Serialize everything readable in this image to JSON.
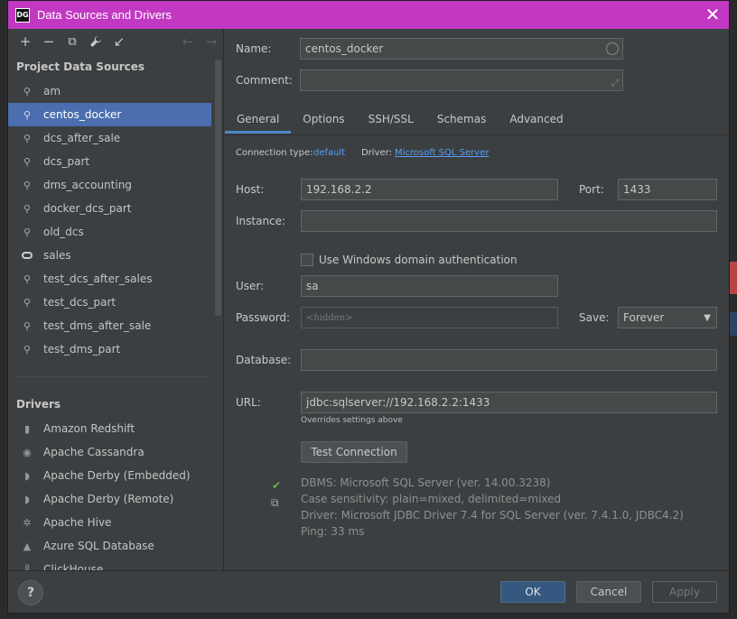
{
  "window": {
    "app_logo": "DG",
    "title": "Data Sources and Drivers",
    "close": "✕"
  },
  "toolbar": {
    "add": "+",
    "remove": "−",
    "duplicate": "⧉",
    "settings": "🔧",
    "import": "↙",
    "back": "←",
    "forward": "→"
  },
  "left": {
    "project_title": "Project Data Sources",
    "data_sources": [
      {
        "label": "am",
        "icon": "db-plug-icon"
      },
      {
        "label": "centos_docker",
        "icon": "db-plug-icon",
        "selected": true
      },
      {
        "label": "dcs_after_sale",
        "icon": "db-plug-icon"
      },
      {
        "label": "dcs_part",
        "icon": "db-plug-icon"
      },
      {
        "label": "dms_accounting",
        "icon": "db-plug-icon"
      },
      {
        "label": "docker_dcs_part",
        "icon": "db-plug-icon"
      },
      {
        "label": "old_dcs",
        "icon": "db-plug-icon"
      },
      {
        "label": "sales",
        "icon": "oracle-icon"
      },
      {
        "label": "test_dcs_after_sales",
        "icon": "db-plug-icon"
      },
      {
        "label": "test_dcs_part",
        "icon": "db-plug-icon"
      },
      {
        "label": "test_dms_after_sale",
        "icon": "db-plug-icon"
      },
      {
        "label": "test_dms_part",
        "icon": "db-plug-icon"
      }
    ],
    "drivers_title": "Drivers",
    "drivers": [
      {
        "label": "Amazon Redshift",
        "icon": "redshift-icon"
      },
      {
        "label": "Apache Cassandra",
        "icon": "cassandra-icon"
      },
      {
        "label": "Apache Derby (Embedded)",
        "icon": "derby-icon"
      },
      {
        "label": "Apache Derby (Remote)",
        "icon": "derby-icon"
      },
      {
        "label": "Apache Hive",
        "icon": "hive-icon"
      },
      {
        "label": "Azure SQL Database",
        "icon": "azure-icon"
      },
      {
        "label": "ClickHouse",
        "icon": "clickhouse-icon"
      }
    ]
  },
  "form": {
    "name_label": "Name:",
    "name_value": "centos_docker",
    "comment_label": "Comment:",
    "comment_value": "",
    "tabs": [
      "General",
      "Options",
      "SSH/SSL",
      "Schemas",
      "Advanced"
    ],
    "active_tab": "General",
    "conn_type_label": "Connection type:",
    "conn_type_value": "default",
    "driver_label": "Driver:",
    "driver_value": "Microsoft SQL Server",
    "host_label": "Host:",
    "host_value": "192.168.2.2",
    "port_label": "Port:",
    "port_value": "1433",
    "instance_label": "Instance:",
    "instance_value": "",
    "windows_auth_label": "Use Windows domain authentication",
    "user_label": "User:",
    "user_value": "sa",
    "password_label": "Password:",
    "password_placeholder": "<hidden>",
    "save_label": "Save:",
    "save_value": "Forever",
    "database_label": "Database:",
    "database_value": "",
    "url_label": "URL:",
    "url_value": "jdbc:sqlserver://192.168.2.2:1433",
    "url_hint": "Overrides settings above",
    "test_button": "Test Connection",
    "info_lines": [
      "DBMS: Microsoft SQL Server (ver. 14.00.3238)",
      "Case sensitivity: plain=mixed, delimited=mixed",
      "Driver: Microsoft JDBC Driver 7.4 for SQL Server (ver. 7.4.1.0, JDBC4.2)",
      "Ping: 33 ms"
    ]
  },
  "footer": {
    "help": "?",
    "ok": "OK",
    "cancel": "Cancel",
    "apply": "Apply"
  },
  "colors": {
    "title_bar": "#c238c2",
    "selection": "#4b6eaf",
    "primary_button": "#365880",
    "link": "#589df6",
    "success": "#62b543"
  }
}
